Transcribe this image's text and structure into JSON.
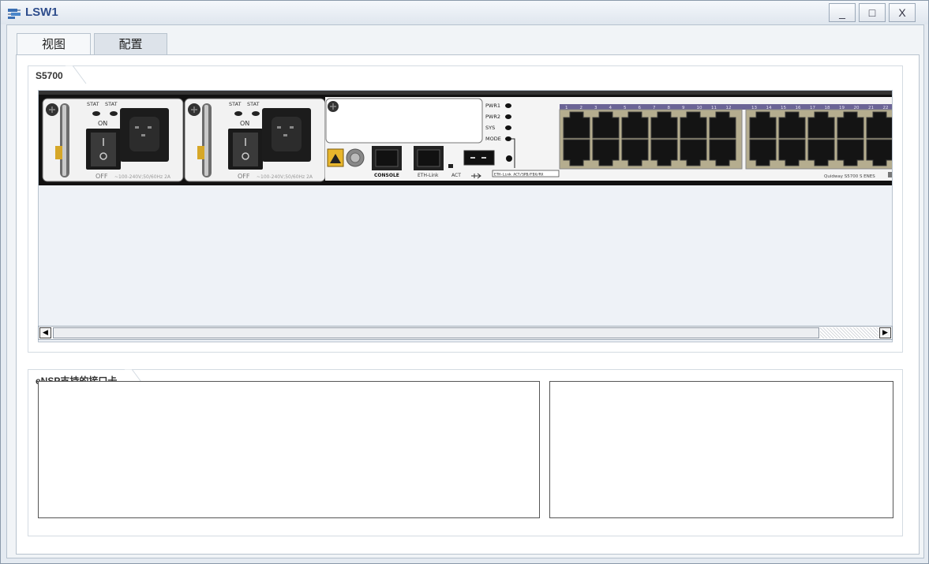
{
  "window": {
    "title": "LSW1",
    "minimize": "_",
    "maximize": "□",
    "close": "X"
  },
  "tabs": [
    {
      "label": "视图",
      "selected": false
    },
    {
      "label": "配置",
      "selected": true
    }
  ],
  "device_panel": {
    "label": "S5700",
    "power_modules": [
      {
        "led_labels": [
          "STAT",
          "STAT"
        ],
        "switch_on": "ON",
        "switch_off": "OFF",
        "rating": "~100-240V;50/60Hz 2A"
      },
      {
        "led_labels": [
          "STAT",
          "STAT"
        ],
        "switch_on": "ON",
        "switch_off": "OFF",
        "rating": "~100-240V;50/60Hz 2A"
      }
    ],
    "port_labels": {
      "console": "CONSOLE",
      "eth": "ETH-Link",
      "act": "ACT"
    },
    "indicators": [
      "PWR1",
      "PWR2",
      "SYS",
      "MODE"
    ],
    "indicator_legend": "ETH-Link ACT/SPD/FDX/RX",
    "port_numbers": [
      "1",
      "2",
      "3",
      "4",
      "5",
      "6",
      "7",
      "8",
      "9",
      "10",
      "11",
      "12",
      "13",
      "14",
      "15",
      "16",
      "17",
      "18",
      "19",
      "20",
      "21",
      "22"
    ],
    "model": "Quidway S5700 S ENES"
  },
  "card_panel": {
    "label": "eNSP支持的接口卡"
  },
  "colors": {
    "accent": "#2e4d8c",
    "port_strip": "#6b6496",
    "port_bezel": "#b5ad8f"
  }
}
